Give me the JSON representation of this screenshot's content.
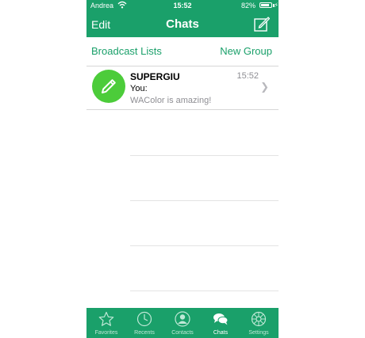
{
  "status_bar": {
    "carrier": "Andrea",
    "time": "15:52",
    "battery": "82%",
    "battery_level": 0.82
  },
  "nav": {
    "edit_label": "Edit",
    "title": "Chats",
    "compose_icon": "compose-icon"
  },
  "subheader": {
    "left_link": "Broadcast Lists",
    "right_link": "New Group"
  },
  "chats": [
    {
      "name": "SUPERGIU",
      "time": "15:52",
      "sender": "You:",
      "preview": "WAColor is amazing!"
    }
  ],
  "tabs": [
    {
      "label": "Favorites",
      "icon": "star-icon"
    },
    {
      "label": "Recents",
      "icon": "clock-icon"
    },
    {
      "label": "Contacts",
      "icon": "contact-icon"
    },
    {
      "label": "Chats",
      "icon": "chats-icon",
      "active": true
    },
    {
      "label": "Settings",
      "icon": "gear-icon"
    }
  ],
  "colors": {
    "accent": "#1aa06a",
    "avatar": "#4ccc3a",
    "secondary_text": "#8e8e93"
  }
}
